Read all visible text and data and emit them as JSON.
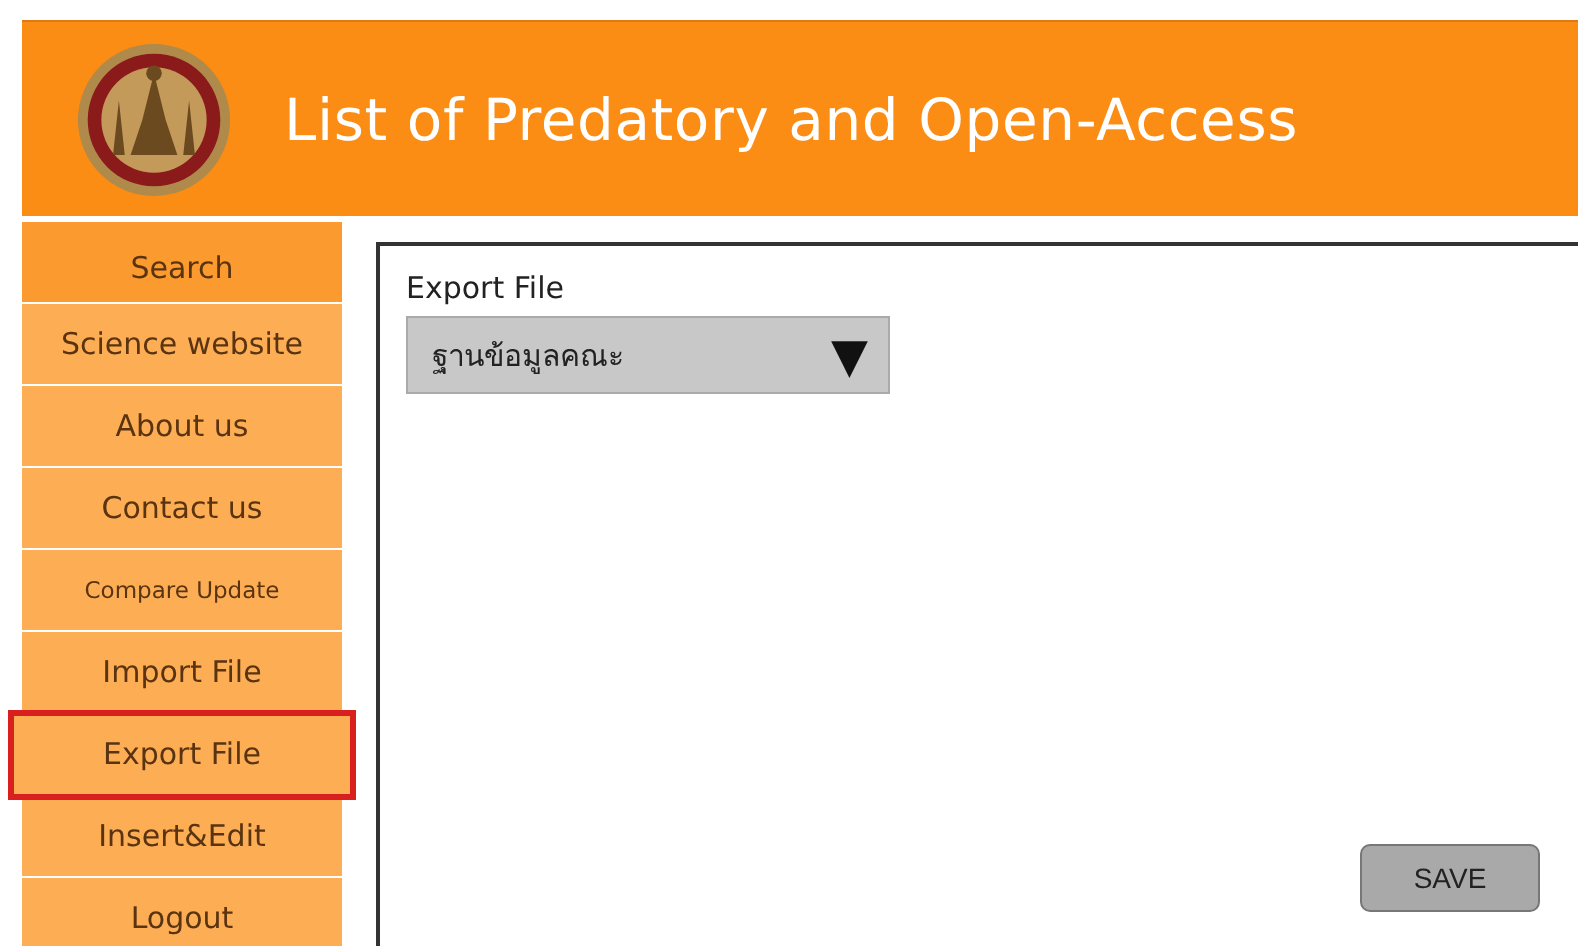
{
  "header": {
    "title": "List of Predatory and Open-Access"
  },
  "sidebar": {
    "items": [
      {
        "label": "Search",
        "kind": "heading",
        "selected": false
      },
      {
        "label": "Science website",
        "kind": "link",
        "selected": false
      },
      {
        "label": "About us",
        "kind": "link",
        "selected": false
      },
      {
        "label": "Contact us",
        "kind": "link",
        "selected": false
      },
      {
        "label": "Compare Update",
        "kind": "small",
        "selected": false
      },
      {
        "label": "Import File",
        "kind": "link",
        "selected": false
      },
      {
        "label": "Export File",
        "kind": "link",
        "selected": true
      },
      {
        "label": "Insert&Edit",
        "kind": "link",
        "selected": false
      },
      {
        "label": "Logout",
        "kind": "link",
        "selected": false
      }
    ]
  },
  "panel": {
    "label": "Export File",
    "select": {
      "value": "ฐานข้อมูลคณะ",
      "arrow": "▼"
    },
    "save_button": "SAVE"
  }
}
